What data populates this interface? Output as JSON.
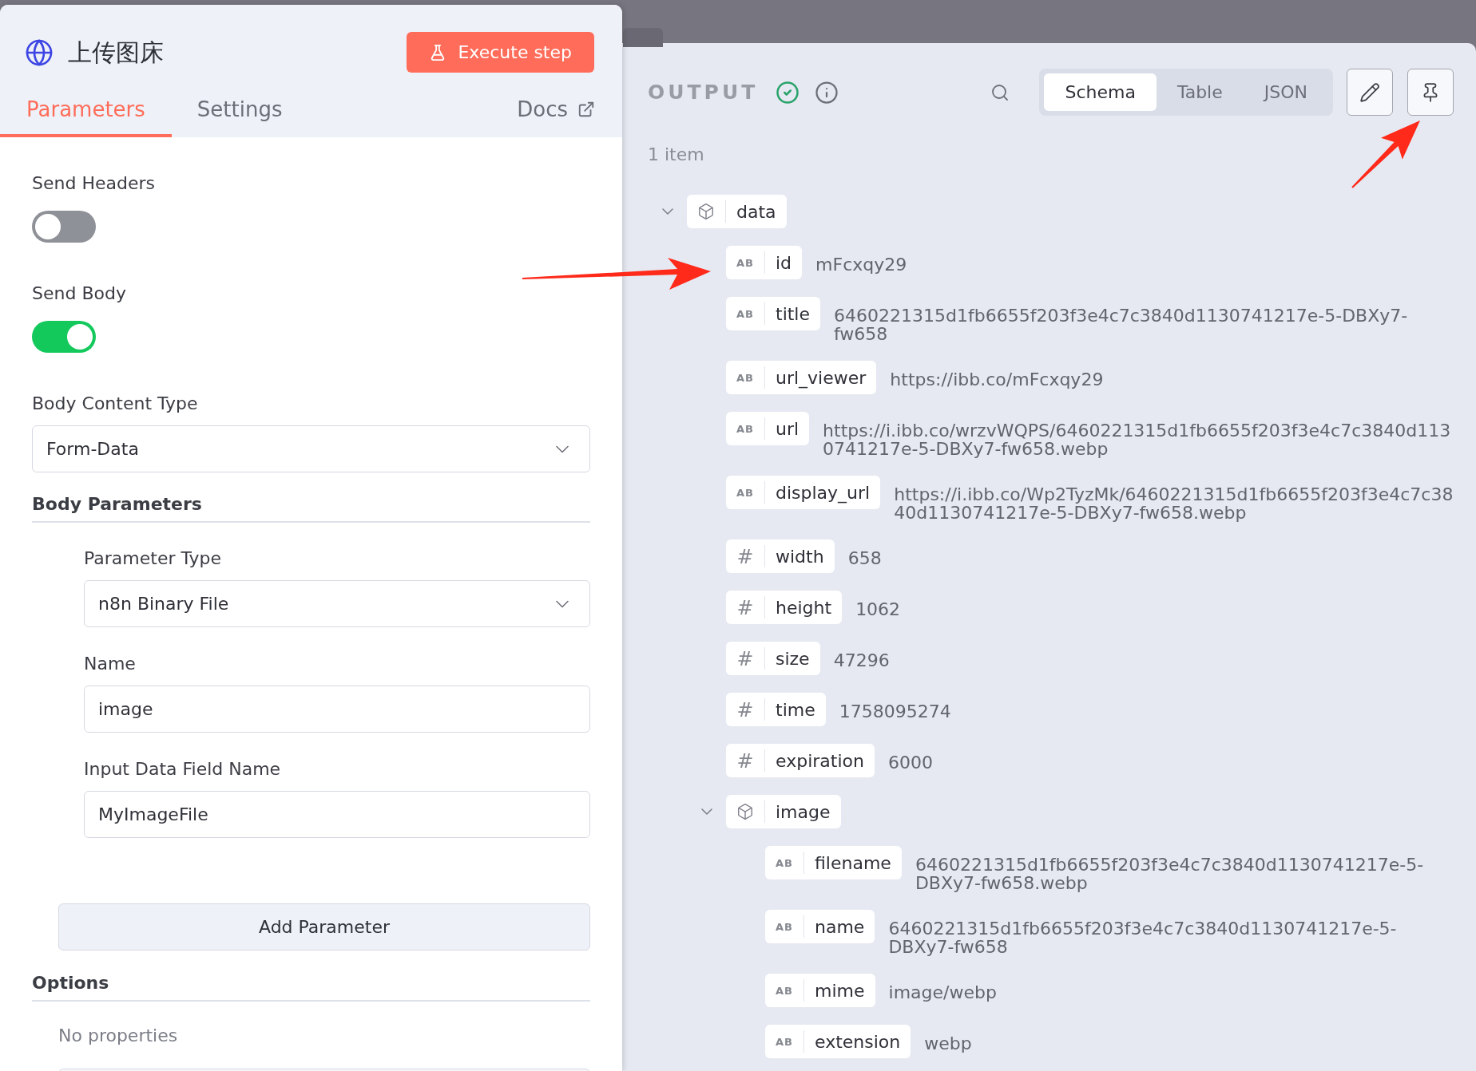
{
  "node": {
    "title": "上传图床",
    "execute_button": "Execute step",
    "tabs": [
      {
        "label": "Parameters",
        "selected": true
      },
      {
        "label": "Settings",
        "selected": false
      }
    ],
    "docs_link": "Docs"
  },
  "parameters": [
    {
      "kind": "toggle",
      "label": "Send Headers",
      "on": false
    },
    {
      "kind": "toggle",
      "label": "Send Body",
      "on": true
    },
    {
      "kind": "select",
      "label": "Body Content Type",
      "value": "Form-Data"
    }
  ],
  "body_parameters": {
    "title": "Body Parameters",
    "fields": [
      {
        "kind": "select",
        "label": "Parameter Type",
        "value": "n8n Binary File"
      },
      {
        "kind": "input",
        "label": "Name",
        "value": "image"
      },
      {
        "kind": "input",
        "label": "Input Data Field Name",
        "value": "MyImageFile"
      }
    ],
    "add_button": "Add Parameter"
  },
  "options": {
    "title": "Options",
    "empty_text": "No properties"
  },
  "output": {
    "title": "OUTPUT",
    "views": [
      {
        "label": "Schema",
        "selected": true
      },
      {
        "label": "Table",
        "selected": false
      },
      {
        "label": "JSON",
        "selected": false
      }
    ],
    "item_count": "1 item",
    "schema": [
      {
        "kind": "object",
        "key": "data",
        "expanded": true,
        "children": [
          {
            "kind": "string",
            "glyph": "AB",
            "key": "id",
            "value": "mFcxqy29"
          },
          {
            "kind": "string",
            "glyph": "AB",
            "key": "title",
            "value": "6460221315d1fb6655f203f3e4c7c3840d1130741217e-5-DBXy7-fw658"
          },
          {
            "kind": "string",
            "glyph": "AB",
            "key": "url_viewer",
            "value": "https://ibb.co/mFcxqy29"
          },
          {
            "kind": "string",
            "glyph": "AB",
            "key": "url",
            "value": "https://i.ibb.co/wrzvWQPS/6460221315d1fb6655f203f3e4c7c3840d1130741217e-5-DBXy7-fw658.webp"
          },
          {
            "kind": "string",
            "glyph": "AB",
            "key": "display_url",
            "value": "https://i.ibb.co/Wp2TyzMk/6460221315d1fb6655f203f3e4c7c3840d1130741217e-5-DBXy7-fw658.webp"
          },
          {
            "kind": "number",
            "glyph": "#",
            "key": "width",
            "value": "658"
          },
          {
            "kind": "number",
            "glyph": "#",
            "key": "height",
            "value": "1062"
          },
          {
            "kind": "number",
            "glyph": "#",
            "key": "size",
            "value": "47296"
          },
          {
            "kind": "number",
            "glyph": "#",
            "key": "time",
            "value": "1758095274"
          },
          {
            "kind": "number",
            "glyph": "#",
            "key": "expiration",
            "value": "6000"
          },
          {
            "kind": "object",
            "key": "image",
            "expanded": true,
            "children": [
              {
                "kind": "string",
                "glyph": "AB",
                "key": "filename",
                "value": "6460221315d1fb6655f203f3e4c7c3840d1130741217e-5-DBXy7-fw658.webp"
              },
              {
                "kind": "string",
                "glyph": "AB",
                "key": "name",
                "value": "6460221315d1fb6655f203f3e4c7c3840d1130741217e-5-DBXy7-fw658"
              },
              {
                "kind": "string",
                "glyph": "AB",
                "key": "mime",
                "value": "image/webp"
              },
              {
                "kind": "string",
                "glyph": "AB",
                "key": "extension",
                "value": "webp"
              }
            ]
          }
        ]
      }
    ]
  }
}
